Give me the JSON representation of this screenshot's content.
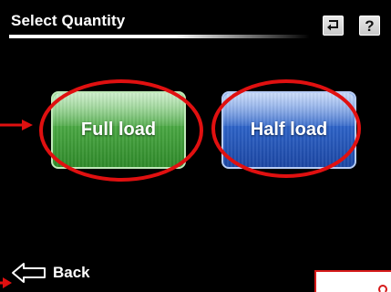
{
  "header": {
    "title": "Select Quantity",
    "back_button_icon": "return-arrow-icon",
    "help_button_label": "?"
  },
  "main": {
    "options": [
      {
        "label": "Full load",
        "color": "#3c9c35"
      },
      {
        "label": "Half load",
        "color": "#2a5ec4"
      }
    ]
  },
  "footer": {
    "back_label": "Back",
    "back_icon": "left-arrow-icon"
  },
  "annotations": {
    "highlight_color": "#e01010",
    "arrow_color": "#e01010"
  }
}
